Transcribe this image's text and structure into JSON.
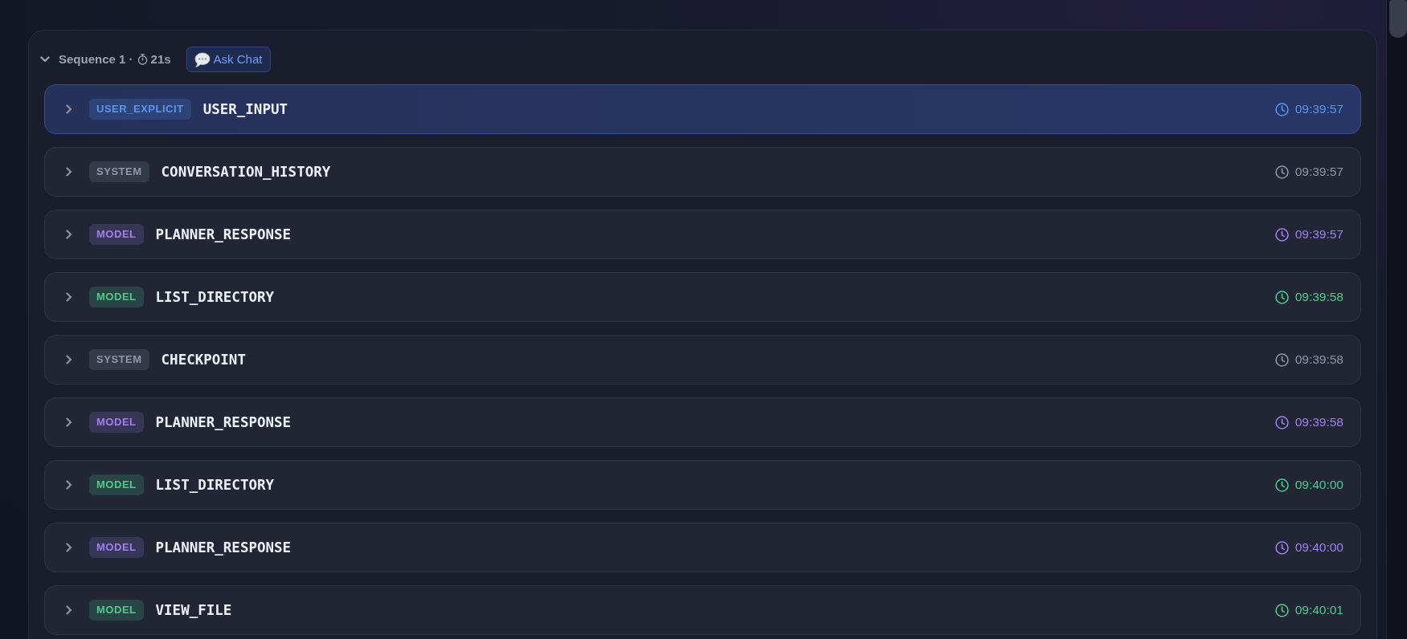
{
  "sequence": {
    "label": "Sequence 1 ·",
    "duration": "21s",
    "expanded": true,
    "ask_button": "Ask Chat"
  },
  "rows": [
    {
      "badge": "USER_EXPLICIT",
      "title": "USER_INPUT",
      "time": "09:39:57",
      "color": "#5b93f0",
      "selected": true,
      "expanded": false
    },
    {
      "badge": "SYSTEM",
      "title": "CONVERSATION_HISTORY",
      "time": "09:39:57",
      "color": "#8f96a8",
      "selected": false,
      "expanded": false
    },
    {
      "badge": "MODEL",
      "title": "PLANNER_RESPONSE",
      "time": "09:39:57",
      "color": "#a27ff0",
      "selected": false,
      "expanded": false
    },
    {
      "badge": "MODEL",
      "title": "LIST_DIRECTORY",
      "time": "09:39:58",
      "color": "#4fcb8c",
      "selected": false,
      "expanded": false
    },
    {
      "badge": "SYSTEM",
      "title": "CHECKPOINT",
      "time": "09:39:58",
      "color": "#8f96a8",
      "selected": false,
      "expanded": false
    },
    {
      "badge": "MODEL",
      "title": "PLANNER_RESPONSE",
      "time": "09:39:58",
      "color": "#a27ff0",
      "selected": false,
      "expanded": false
    },
    {
      "badge": "MODEL",
      "title": "LIST_DIRECTORY",
      "time": "09:40:00",
      "color": "#4fcb8c",
      "selected": false,
      "expanded": false
    },
    {
      "badge": "MODEL",
      "title": "PLANNER_RESPONSE",
      "time": "09:40:00",
      "color": "#a27ff0",
      "selected": false,
      "expanded": false
    },
    {
      "badge": "MODEL",
      "title": "VIEW_FILE",
      "time": "09:40:01",
      "color": "#4fcb8c",
      "selected": false,
      "expanded": false
    }
  ]
}
